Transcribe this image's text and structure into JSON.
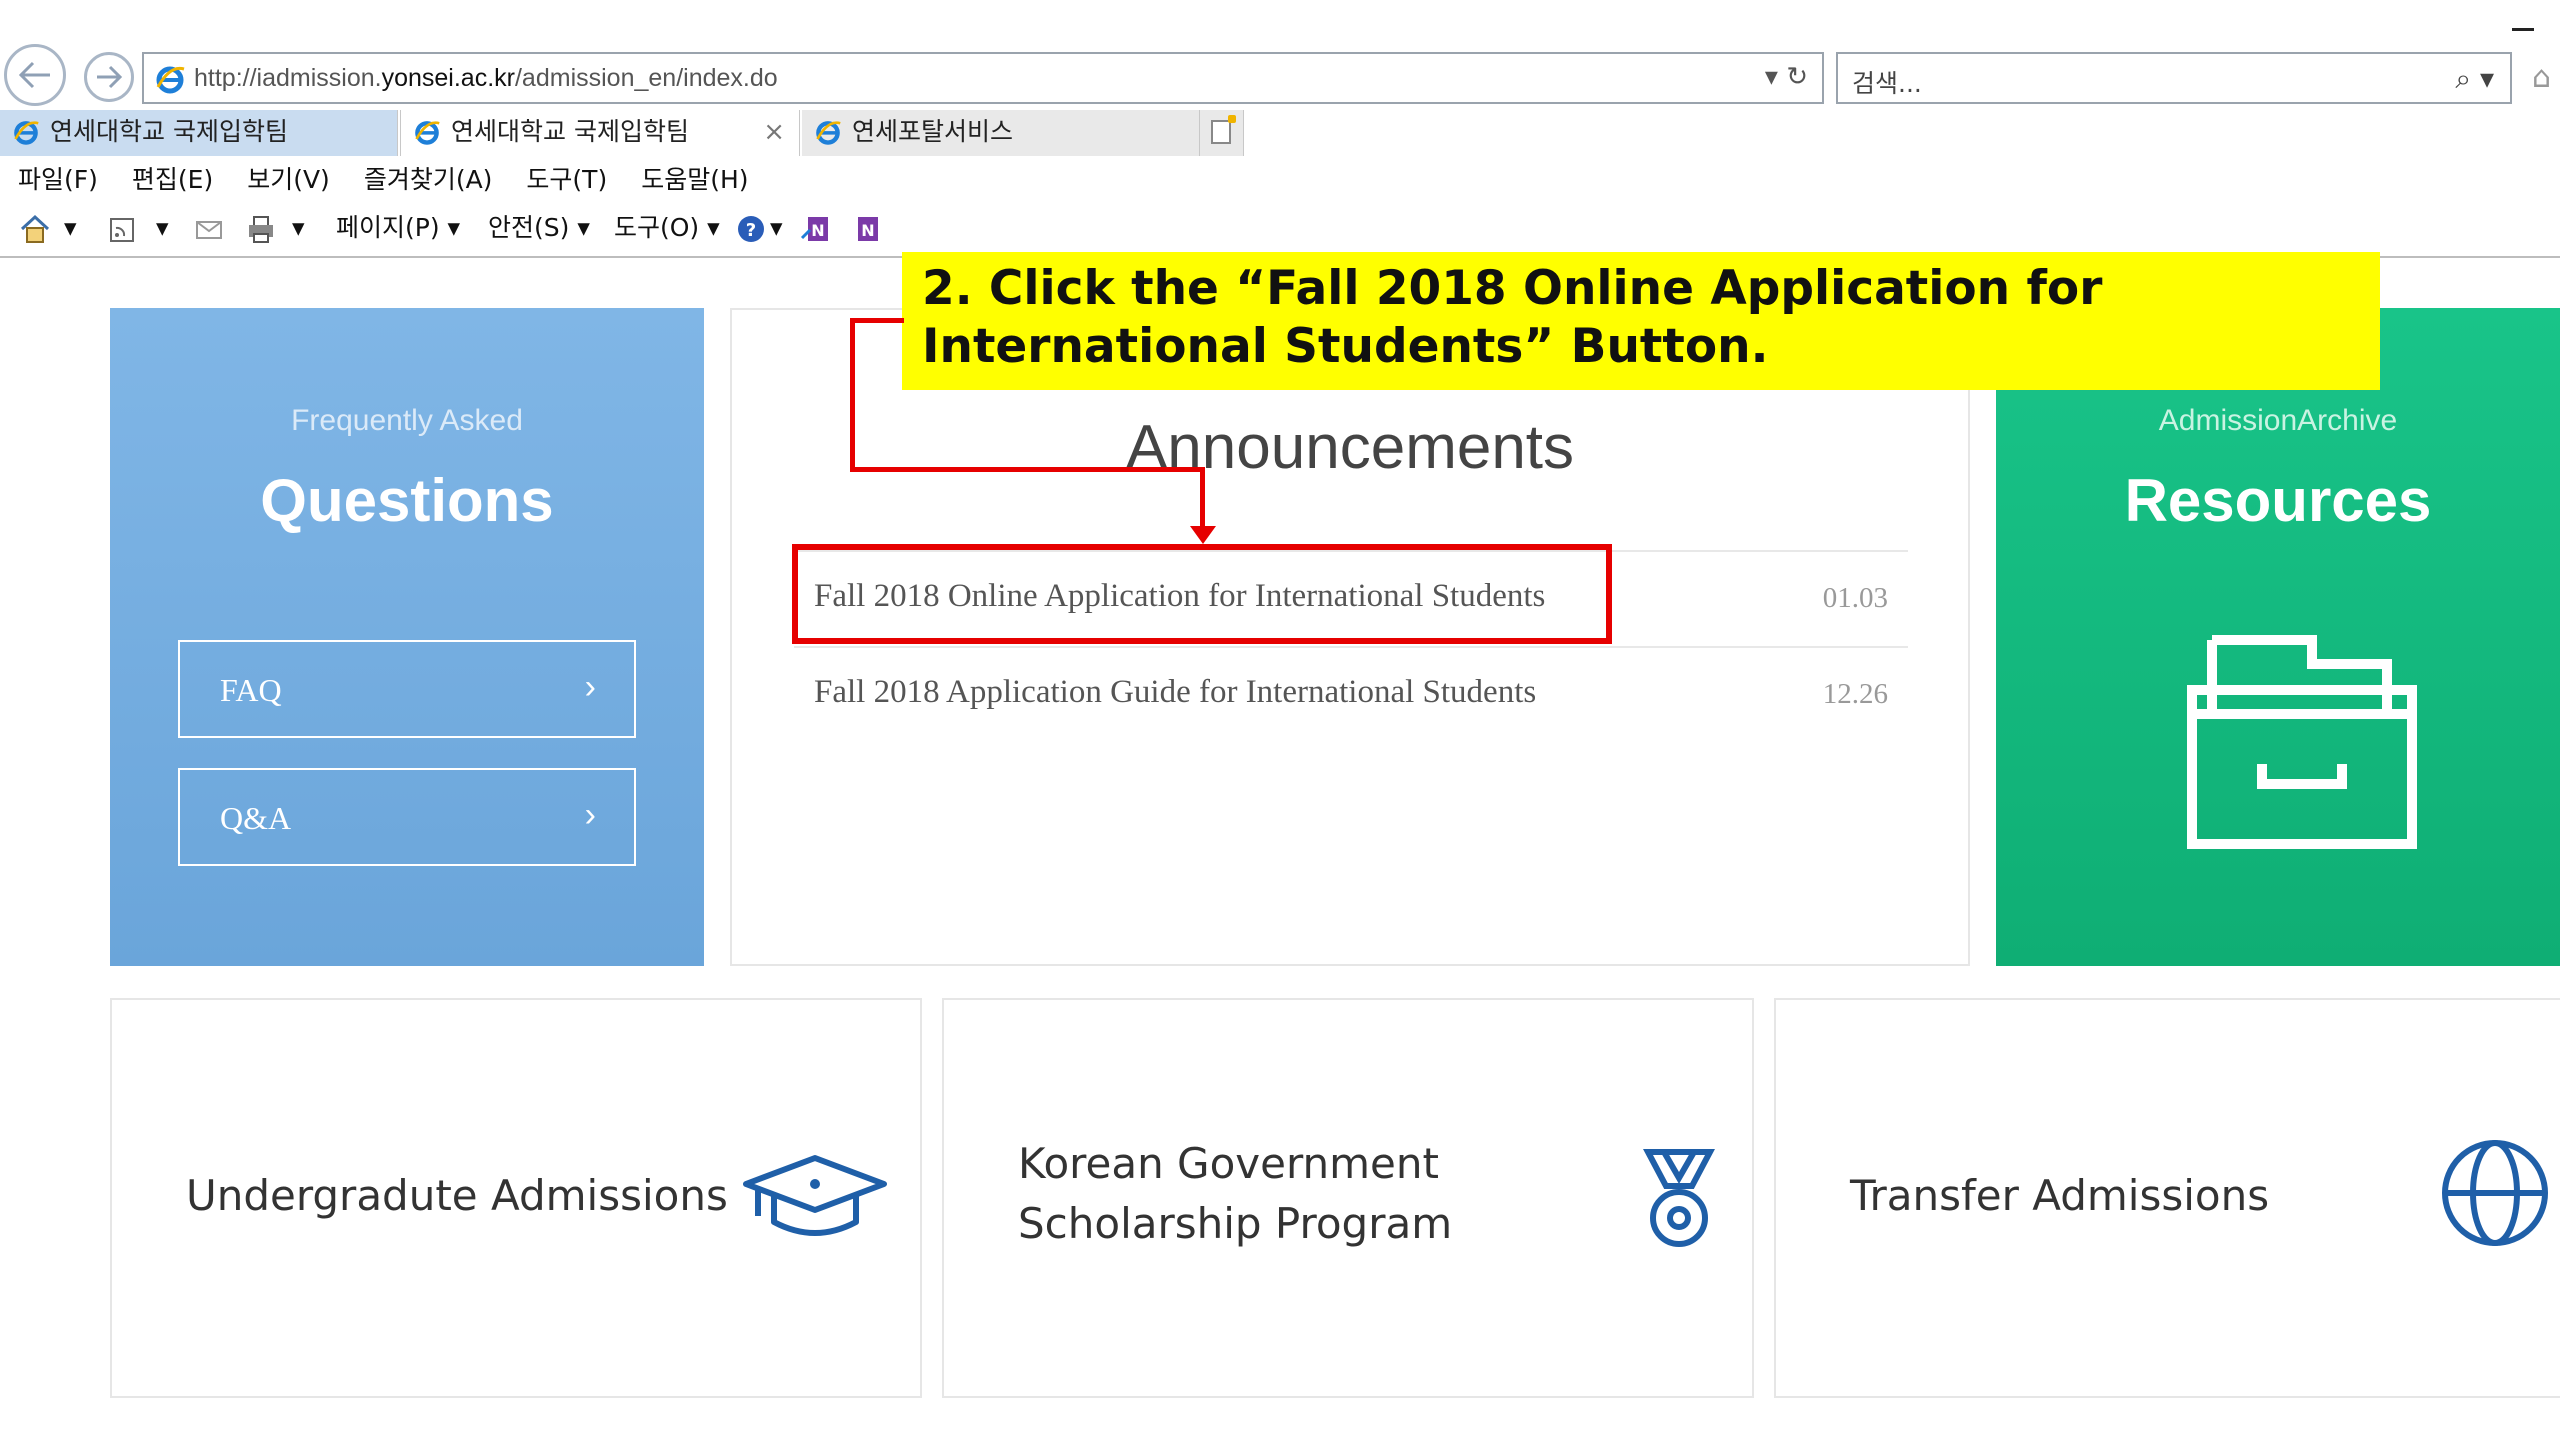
{
  "browser": {
    "url_prefix": "http://iadmission.",
    "url_domain": "yonsei.ac.kr",
    "url_suffix": "/admission_en/index.do",
    "url_controls": "▾ ↻",
    "search_placeholder": "검색...",
    "search_controls": "⌕ ▾",
    "tabs": [
      {
        "label": "연세대학교 국제입학팀"
      },
      {
        "label": "연세대학교 국제입학팀",
        "close": "×"
      },
      {
        "label": "연세포탈서비스"
      }
    ],
    "menu": [
      "파일(F)",
      "편집(E)",
      "보기(V)",
      "즐겨찾기(A)",
      "도구(T)",
      "도움말(H)"
    ],
    "command_bar": {
      "page": "페이지(P) ▾",
      "safety": "안전(S) ▾",
      "tools": "도구(O) ▾",
      "help": "▾",
      "home_arrow": "▾",
      "feed_arrow": "▾",
      "print_arrow": "▾"
    }
  },
  "faq_panel": {
    "subtitle": "Frequently Asked",
    "title": "Questions",
    "buttons": [
      {
        "label": "FAQ",
        "arrow": "›"
      },
      {
        "label": "Q&A",
        "arrow": "›"
      }
    ]
  },
  "announcements": {
    "title": "Announcements",
    "items": [
      {
        "title": "Fall 2018 Online Application for International Students",
        "date": "01.03"
      },
      {
        "title": "Fall 2018 Application Guide for International Students",
        "date": "12.26"
      }
    ]
  },
  "resources_panel": {
    "subtitle": "AdmissionArchive",
    "title": "Resources",
    "icon": "archive-drawer-icon"
  },
  "cards": [
    {
      "line1": "Undergradute Admissions",
      "line2": "",
      "icon": "graduation-cap-icon"
    },
    {
      "line1": "Korean Government",
      "line2": "Scholarship Program",
      "icon": "medal-icon"
    },
    {
      "line1": "Transfer Admissions",
      "line2": "",
      "icon": "globe-icon"
    }
  ],
  "tutorial_callout": {
    "text": "2. Click the “Fall 2018 Online Application for International Students” Button."
  },
  "colors": {
    "faq_blue": "#6aa5da",
    "resources_green": "#0fae74",
    "callout_yellow": "#ffff00",
    "highlight_red": "#e60000",
    "icon_blue": "#1f5fa8"
  }
}
